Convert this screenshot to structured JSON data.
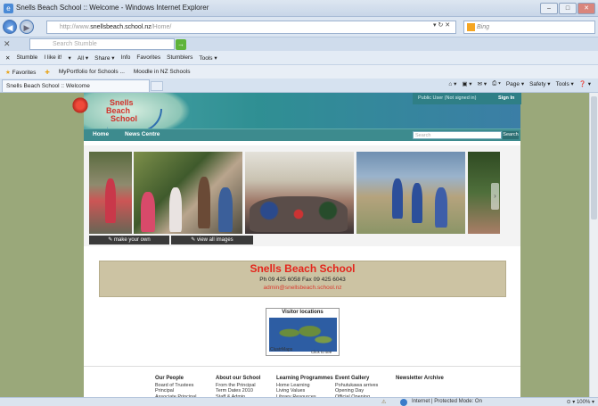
{
  "window": {
    "title": "Snells Beach School :: Welcome - Windows Internet Explorer",
    "min": "–",
    "max": "□",
    "close": "✕"
  },
  "address": {
    "prefix": "http://www.",
    "domain": "snellsbeach.school.nz",
    "path": "/Home/",
    "controls": "▾ ↻ ✕",
    "search_placeholder": "Bing"
  },
  "stumble": {
    "close": "✕",
    "placeholder": "Search Stumble",
    "go": "→"
  },
  "toolbar2": {
    "items": [
      "✕",
      "Stumble",
      "I like it!",
      "▾",
      "All ▾",
      "Share ▾",
      "Info",
      "Favorites",
      "Stumblers",
      "Tools ▾"
    ]
  },
  "favbar": {
    "favorites_label": "Favorites",
    "links": [
      "MyPortfolio for Schools ...",
      "Moodle in NZ Schools"
    ]
  },
  "tab": {
    "label": "Snells Beach School :: Welcome"
  },
  "cmdbar": {
    "items": [
      "⌂ ▾",
      "▣ ▾",
      "✉ ▾",
      "⎙ ▾",
      "Page ▾",
      "Safety ▾",
      "Tools ▾",
      "❓ ▾"
    ]
  },
  "site": {
    "logo_line1": "Snells",
    "logo_line2": "Beach",
    "logo_line3": "School",
    "login_status": "Public User (Not signed in)",
    "signin": "Sign In",
    "nav": [
      "Home",
      "News Centre"
    ],
    "search_placeholder": "Search",
    "search_button": "Search",
    "gallery_button1": "✎ make your own",
    "gallery_button2": "✎ view all images",
    "gallery_arrow": "›",
    "school_name": "Snells Beach School",
    "phone": "Ph 09 425 6058 Fax 09 425 6043",
    "email": "admin@snellsbeach.school.nz",
    "visitor_title": "Visitor locations",
    "clustrmaps": "ClustrMaps",
    "click_to_see": "Click to see"
  },
  "footer": {
    "columns": [
      {
        "heading": "Our People",
        "items": [
          "Board of Trustees",
          "Principal",
          "Associate Principal"
        ]
      },
      {
        "heading": "About our School",
        "items": [
          "From the Principal",
          "Term Dates 2010",
          "Staff & Admin"
        ]
      },
      {
        "heading": "Learning Programmes",
        "items": [
          "Home Learning",
          "Living Values",
          "Library Resources"
        ]
      },
      {
        "heading": "Event Gallery",
        "items": [
          "Pohutukawa arrives",
          "Opening Day",
          "Official Opening"
        ]
      },
      {
        "heading": "Newsletter Archive",
        "items": []
      }
    ]
  },
  "status": {
    "warning": "⚠",
    "zone": "Internet | Protected Mode: On",
    "zoom": "⊙ ▾  100% ▾"
  },
  "colors": {
    "header_teal": "#3d8b8e",
    "school_red": "#e4261d",
    "info_tan": "#ccc3a3"
  }
}
